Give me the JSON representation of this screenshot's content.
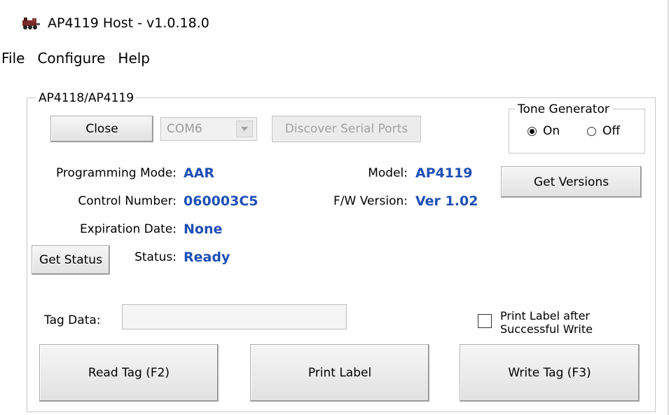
{
  "window": {
    "title": "AP4119 Host - v1.0.18.0",
    "icon": "locomotive-icon"
  },
  "menu": {
    "items": [
      "File",
      "Configure",
      "Help"
    ]
  },
  "group": {
    "legend": "AP4118/AP4119",
    "close_button": "Close",
    "port": {
      "value": "COM6",
      "arrow_icon": "chevron-down-icon"
    },
    "discover_button": "Discover Serial Ports",
    "tone": {
      "legend": "Tone Generator",
      "on_label": "On",
      "off_label": "Off",
      "selected": "On"
    },
    "info": {
      "programming_mode_label": "Programming Mode:",
      "programming_mode": "AAR",
      "control_number_label": "Control Number:",
      "control_number": "060003C5",
      "expiration_label": "Expiration Date:",
      "expiration": "None",
      "status_label": "Status:",
      "status": "Ready",
      "model_label": "Model:",
      "model": "AP4119",
      "fw_label": "F/W Version:",
      "fw": "Ver 1.02"
    },
    "get_versions_button": "Get Versions",
    "get_status_button": "Get Status",
    "tag_data_label": "Tag Data:",
    "tag_data_value": "",
    "print_after_write_label_line1": "Print Label after",
    "print_after_write_label_line2": "Successful Write",
    "print_after_write_checked": false,
    "read_tag_button": "Read Tag (F2)",
    "print_label_button": "Print Label",
    "write_tag_button": "Write Tag (F3)"
  },
  "colors": {
    "value_blue": "#1e4fb4",
    "disabled_text": "#a0a0a0"
  }
}
